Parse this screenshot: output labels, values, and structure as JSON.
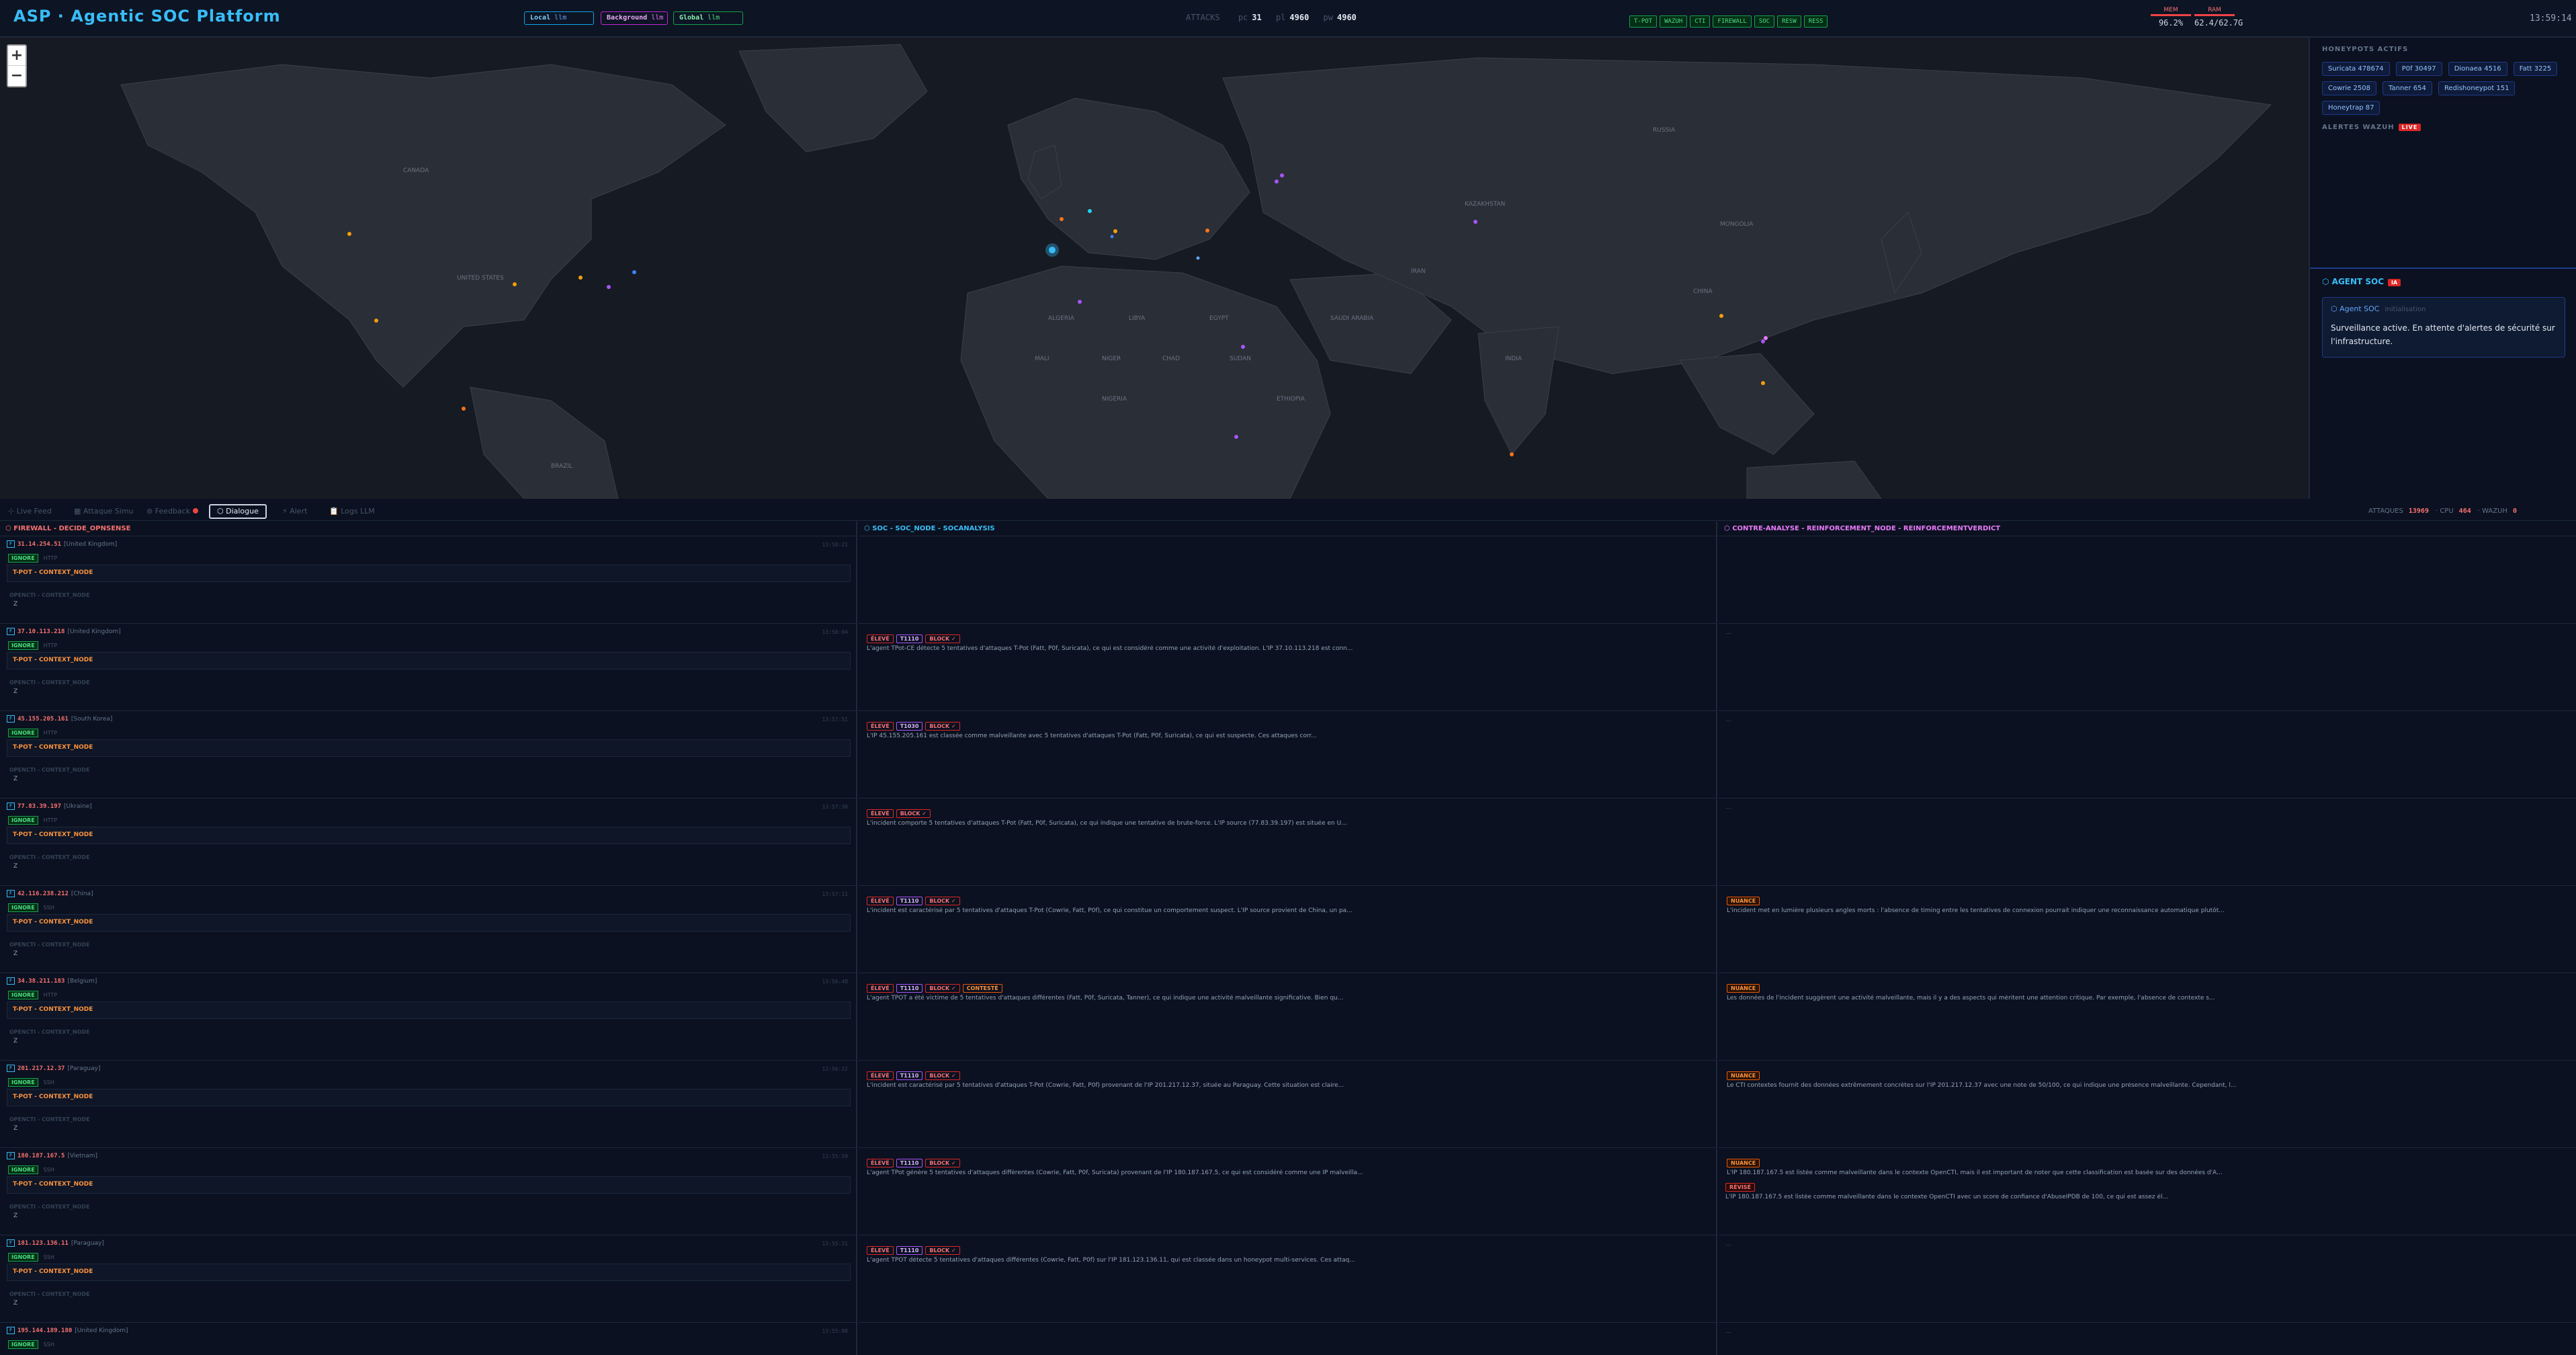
{
  "header": {
    "title": "ASP · Agentic SOC Platform",
    "llm": [
      {
        "key": "Local",
        "value": "llm"
      },
      {
        "key": "Background",
        "value": "llm"
      },
      {
        "key": "Global",
        "value": "llm"
      }
    ],
    "stats": [
      {
        "label": "ATTACKS",
        "value": ""
      },
      {
        "label": "pc",
        "value": "31"
      },
      {
        "label": "pl",
        "value": "4960"
      },
      {
        "label": "pw",
        "value": "4960"
      }
    ],
    "modules": [
      "T-POT",
      "WAZUH",
      "CTI",
      "FIREWALL",
      "SOC",
      "RESW",
      "RESS"
    ],
    "gauges": [
      {
        "label": "MEM",
        "value": "96.2%"
      },
      {
        "label": "RAM",
        "value": "62.4/62.7G"
      }
    ],
    "clock": "13:59:14"
  },
  "map": {
    "zoom_in": "+",
    "zoom_out": "−",
    "labels": [
      "UNITED STATES",
      "CANADA",
      "BRAZIL",
      "ALGERIA",
      "LIBYA",
      "EGYPT",
      "MALI",
      "NIGER",
      "CHAD",
      "SUDAN",
      "SAUDI ARABIA",
      "IRAN",
      "INDIA",
      "CHINA",
      "MONGOLIA",
      "KAZAKHSTAN",
      "RUSSIA",
      "ETHIOPIA",
      "NIGERIA"
    ]
  },
  "honeypots": {
    "title": "HONEYPOTS ACTIFS",
    "items": [
      "Suricata 478674",
      "P0f 30497",
      "Dionaea 4516",
      "Fatt 3225",
      "Cowrie 2508",
      "Tanner 654",
      "Redishoneypot 151",
      "Honeytrap 87"
    ]
  },
  "alerts": {
    "title": "ALERTES WAZUH",
    "live": "LIVE"
  },
  "agent": {
    "title": "⬡ AGENT SOC",
    "count": "IA",
    "sender": "⬡ Agent SOC",
    "status": "Initialisation",
    "message": "Surveillance active. En attente d'alertes de sécurité sur l'infrastructure."
  },
  "tabs": [
    {
      "id": "live",
      "label": "⊹ Live Feed"
    },
    {
      "id": "sim",
      "label": "▦ Attaque Simu"
    },
    {
      "id": "feedback",
      "label": "⊚ Feedback"
    },
    {
      "id": "dialogue",
      "label": "⬡ Dialogue"
    },
    {
      "id": "alert",
      "label": "⚡ Alert"
    },
    {
      "id": "logs",
      "label": "📋 Logs LLM"
    }
  ],
  "counts": [
    {
      "label": "ATTAQUES",
      "value": "13969"
    },
    {
      "label": "CPU",
      "value": "464"
    },
    {
      "label": "WAZUH",
      "value": "0"
    }
  ],
  "columns": {
    "firewall": "⬡ FIREWALL - DECIDE_OPNSENSE",
    "soc": "⬡ SOC - SOC_NODE - SOCANALYSIS",
    "contre": "⬡ CONTRE-ANALYSE - REINFORCEMENT_NODE - REINFORCEMENTVERDICT"
  },
  "firewall_rows": [
    {
      "ip": "31.14.254.51",
      "country": "[United Kingdom]",
      "time": "13:58:21",
      "action": "IGNORE",
      "proto": "HTTP",
      "ctx": "T-POT - CONTEXT_NODE",
      "ctx2": "OPENCTI - CONTEXT_NODE",
      "z": "Z"
    },
    {
      "ip": "37.10.113.218",
      "country": "[United Kingdom]",
      "time": "13:58:04",
      "action": "IGNORE",
      "proto": "HTTP",
      "ctx": "T-POT - CONTEXT_NODE",
      "ctx2": "OPENCTI - CONTEXT_NODE",
      "z": "Z"
    },
    {
      "ip": "45.155.205.161",
      "country": "[South Korea]",
      "time": "13:57:51",
      "action": "IGNORE",
      "proto": "HTTP",
      "ctx": "T-POT - CONTEXT_NODE",
      "ctx2": "OPENCTI - CONTEXT_NODE",
      "z": "Z"
    },
    {
      "ip": "77.83.39.197",
      "country": "[Ukraine]",
      "time": "13:57:30",
      "action": "IGNORE",
      "proto": "HTTP",
      "ctx": "T-POT - CONTEXT_NODE",
      "ctx2": "OPENCTI - CONTEXT_NODE",
      "z": "Z"
    },
    {
      "ip": "42.116.238.212",
      "country": "[China]",
      "time": "13:57:11",
      "action": "IGNORE",
      "proto": "SSH",
      "ctx": "T-POT - CONTEXT_NODE",
      "ctx2": "OPENCTI - CONTEXT_NODE",
      "z": "Z"
    },
    {
      "ip": "34.38.211.183",
      "country": "[Belgium]",
      "time": "13:56:48",
      "action": "IGNORE",
      "proto": "HTTP",
      "ctx": "T-POT - CONTEXT_NODE",
      "ctx2": "OPENCTI - CONTEXT_NODE",
      "z": "Z"
    },
    {
      "ip": "201.217.12.37",
      "country": "[Paraguay]",
      "time": "13:56:22",
      "action": "IGNORE",
      "proto": "SSH",
      "ctx": "T-POT - CONTEXT_NODE",
      "ctx2": "OPENCTI - CONTEXT_NODE",
      "z": "Z"
    },
    {
      "ip": "180.187.167.5",
      "country": "[Vietnam]",
      "time": "13:55:59",
      "action": "IGNORE",
      "proto": "SSH",
      "ctx": "T-POT - CONTEXT_NODE",
      "ctx2": "OPENCTI - CONTEXT_NODE",
      "z": "Z"
    },
    {
      "ip": "181.123.136.11",
      "country": "[Paraguay]",
      "time": "13:55:31",
      "action": "IGNORE",
      "proto": "SSH",
      "ctx": "T-POT - CONTEXT_NODE",
      "ctx2": "OPENCTI - CONTEXT_NODE",
      "z": "Z"
    },
    {
      "ip": "195.144.189.180",
      "country": "[United Kingdom]",
      "time": "13:55:08",
      "action": "IGNORE",
      "proto": "SSH",
      "ctx": "",
      "ctx2": "",
      "z": ""
    }
  ],
  "soc_rows": [
    {
      "chips": [],
      "text": ""
    },
    {
      "chips": [
        "ÉLEVÉ",
        "T1110",
        "BLOCK ✓"
      ],
      "text": "L'agent TPot-CE détecte 5 tentatives d'attaques T-Pot (Fatt, P0f, Suricata), ce qui est considéré comme une activité d'exploitation. L'IP 37.10.113.218 est conn..."
    },
    {
      "chips": [
        "ÉLEVÉ",
        "T1030",
        "BLOCK ✓"
      ],
      "text": "L'IP 45.155.205.161 est classée comme malveillante avec 5 tentatives d'attaques T-Pot (Fatt, P0f, Suricata), ce qui est suspecte. Ces attaques corr..."
    },
    {
      "chips": [
        "ÉLEVÉ",
        "BLOCK ✓"
      ],
      "text": "L'incident comporte 5 tentatives d'attaques T-Pot (Fatt, P0f, Suricata), ce qui indique une tentative de brute-force. L'IP source (77.83.39.197) est située en U..."
    },
    {
      "chips": [
        "ÉLEVÉ",
        "T1110",
        "BLOCK ✓"
      ],
      "text": "L'incident est caractérisé par 5 tentatives d'attaques T-Pot (Cowrie, Fatt, P0f), ce qui constitue un comportement suspect. L'IP source provient de China, un pa..."
    },
    {
      "chips": [
        "ÉLEVÉ",
        "T1110",
        "BLOCK ✓",
        "CONTESTÉ"
      ],
      "text": "L'agent TPOT a été victime de 5 tentatives d'attaques différentes (Fatt, P0f, Suricata, Tanner), ce qui indique une activité malveillante significative. Bien qu..."
    },
    {
      "chips": [
        "ÉLEVÉ",
        "T1110",
        "BLOCK ✓"
      ],
      "text": "L'incident est caractérisé par 5 tentatives d'attaques T-Pot (Cowrie, Fatt, P0f) provenant de l'IP 201.217.12.37, située au Paraguay. Cette situation est claire..."
    },
    {
      "chips": [
        "ÉLEVÉ",
        "T1110",
        "BLOCK ✓"
      ],
      "text": "L'agent TPot génère 5 tentatives d'attaques différentes (Cowrie, Fatt, P0f, Suricata) provenant de l'IP 180.187.167.5, ce qui est considéré comme une IP malveilla..."
    },
    {
      "chips": [
        "ÉLEVÉ",
        "T1110",
        "BLOCK ✓"
      ],
      "text": "L'agent TPOT détecte 5 tentatives d'attaques différentes (Cowrie, Fatt, P0f) sur l'IP 181.123.136.11, qui est classée dans un honeypot multi-services. Ces attaq..."
    },
    {
      "chips": [],
      "text": ""
    }
  ],
  "contre_rows": [
    {
      "chip": "",
      "text": "",
      "chip2": "",
      "text2": "",
      "dash": ""
    },
    {
      "chip": "",
      "text": "",
      "chip2": "",
      "text2": "",
      "dash": "—"
    },
    {
      "chip": "",
      "text": "",
      "chip2": "",
      "text2": "",
      "dash": "—"
    },
    {
      "chip": "",
      "text": "",
      "chip2": "",
      "text2": "",
      "dash": "—"
    },
    {
      "chip": "NUANCE",
      "text": "L'incident met en lumière plusieurs angles morts : l'absence de timing entre les tentatives de connexion pourrait indiquer une reconnaissance automatique plutôt...",
      "chip2": "",
      "text2": "",
      "dash": ""
    },
    {
      "chip": "NUANCE",
      "text": "Les données de l'incident suggèrent une activité malveillante, mais il y a des aspects qui méritent une attention critique. Par exemple, l'absence de contexte s...",
      "chip2": "",
      "text2": "",
      "dash": ""
    },
    {
      "chip": "NUANCE",
      "text": "Le CTI contextes fournit des données extrêmement concrètes sur l'IP 201.217.12.37 avec une note de 50/100, ce qui indique une présence malveillante. Cependant, l...",
      "chip2": "",
      "text2": "",
      "dash": ""
    },
    {
      "chip": "NUANCE",
      "text": "L'IP 180.187.167.5 est listée comme malveillante dans le contexte OpenCTI, mais il est important de noter que cette classification est basée sur des données d'A...",
      "chip2": "RÉVISÉ",
      "text2": "L'IP 180.187.167.5 est listée comme malveillante dans le contexte OpenCTI avec un score de confiance d'AbuseIPDB de 100, ce qui est assez él...",
      "dash": ""
    },
    {
      "chip": "",
      "text": "",
      "chip2": "",
      "text2": "",
      "dash": "—"
    },
    {
      "chip": "",
      "text": "",
      "chip2": "",
      "text2": "",
      "dash": "—"
    }
  ]
}
